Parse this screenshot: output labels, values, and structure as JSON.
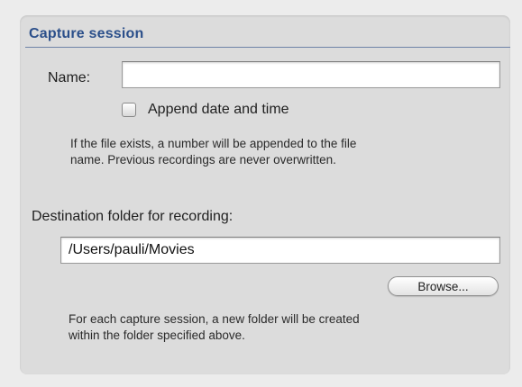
{
  "capture_session": {
    "title": "Capture session",
    "name_label": "Name:",
    "name_value": "",
    "append_label": "Append date and time",
    "append_checked": false,
    "file_exists_note_line1": "If the file exists, a number will be appended to the file",
    "file_exists_note_line2": "name. Previous recordings are never overwritten.",
    "destination_label": "Destination folder for recording:",
    "destination_value": "/Users/pauli/Movies",
    "browse_label": "Browse...",
    "folder_note_line1": "For each capture session, a new folder will be created",
    "folder_note_line2": "within the folder specified above."
  },
  "colors": {
    "title": "#2b4f8a",
    "panel_bg": "#dcdcdc",
    "window_bg": "#ececec"
  }
}
